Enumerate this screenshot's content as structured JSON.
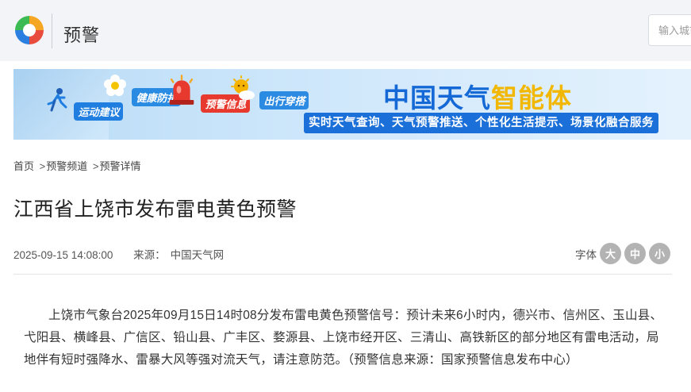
{
  "header": {
    "title": "预警",
    "search_placeholder": "输入城市"
  },
  "banner": {
    "items": [
      {
        "label": "运动建议",
        "icon": "running-person-icon"
      },
      {
        "label": "健康防护",
        "icon": "flower-icon"
      },
      {
        "label": "预警信息",
        "icon": "alarm-siren-icon"
      },
      {
        "label": "出行穿搭",
        "icon": "sun-cloud-icon"
      }
    ],
    "brand_part1": "中国天气",
    "brand_part2": "智能体",
    "subtitle": "实时天气查询、天气预警推送、个性化生活提示、场景化融合服务",
    "colors": {
      "brand_blue": "#1569d6",
      "brand_yellow": "#f2b700",
      "warn_red": "#e8392e"
    }
  },
  "breadcrumb": {
    "home": "首页",
    "channel": "预警频道",
    "detail": "预警详情",
    "separator": ">"
  },
  "article": {
    "title": "江西省上饶市发布雷电黄色预警",
    "datetime": "2025-09-15 14:08:00",
    "source_label": "来源：",
    "source_value": "中国天气网",
    "font_size_label": "字体",
    "font_sizes": [
      "大",
      "中",
      "小"
    ],
    "body": "上饶市气象台2025年09月15日14时08分发布雷电黄色预警信号：预计未来6小时内，德兴市、信州区、玉山县、弋阳县、横峰县、广信区、铅山县、广丰区、婺源县、上饶市经开区、三清山、高铁新区的部分地区有雷电活动，局地伴有短时强降水、雷暴大风等强对流天气，请注意防范。（预警信息来源：国家预警信息发布中心）"
  }
}
